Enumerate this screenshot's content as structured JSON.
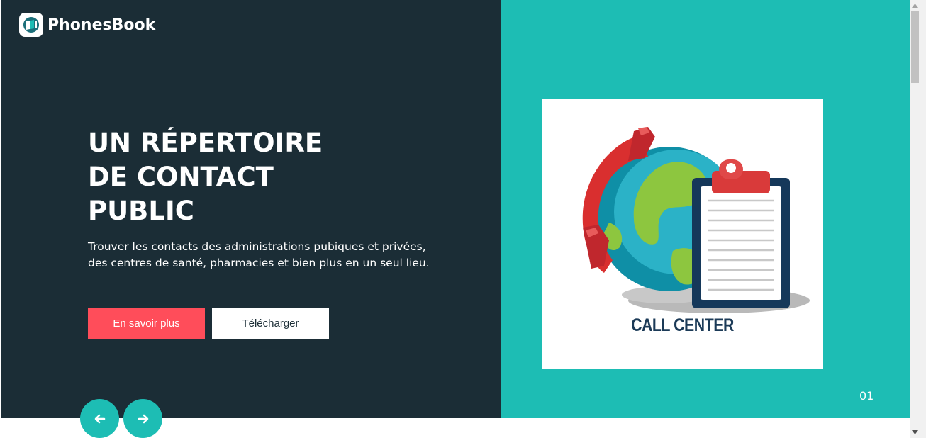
{
  "brand": {
    "name": "PhonesBook"
  },
  "hero": {
    "headline_lines": [
      "UN RÉPERTOIRE",
      "DE CONTACT",
      "PUBLIC"
    ],
    "subtitle_lines": [
      "Trouver les contacts des administrations pubiques et privées,",
      "des centres de santé, pharmacies et bien plus en un seul lieu."
    ],
    "primary_button": "En savoir plus",
    "secondary_button": "Télécharger"
  },
  "illustration": {
    "caption": "CALL CENTER"
  },
  "slider": {
    "counter": "01",
    "prev_icon": "arrow-left-icon",
    "next_icon": "arrow-right-icon"
  },
  "colors": {
    "dark_panel": "#1b2d36",
    "teal_panel": "#1dbdb4",
    "primary_button": "#ff4d5a",
    "white": "#ffffff"
  }
}
